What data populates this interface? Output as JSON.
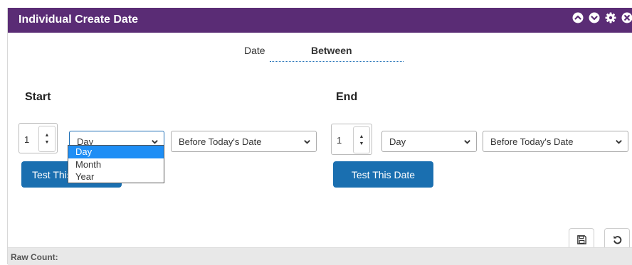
{
  "window": {
    "title": "Individual Create Date"
  },
  "tabs": [
    {
      "label": "Date"
    },
    {
      "label": "Between",
      "active": true
    }
  ],
  "start": {
    "label": "Start",
    "quantity": "1",
    "unit_selected": "Day",
    "relation_selected": "Before Today's Date",
    "test_button": "Test This Date",
    "unit_options": [
      "Day",
      "Month",
      "Year"
    ],
    "highlighted_option": "Day"
  },
  "end": {
    "label": "End",
    "quantity": "1",
    "unit_selected": "Day",
    "relation_selected": "Before Today's Date",
    "test_button": "Test This Date"
  },
  "footer": {
    "raw_count_label": "Raw Count:"
  },
  "icons": {
    "titlebar": [
      "chevron-up-circle-icon",
      "chevron-down-circle-icon",
      "gear-icon",
      "close-circle-icon"
    ],
    "actions": [
      "save-icon",
      "undo-icon"
    ]
  },
  "colors": {
    "titlebar_bg": "#5a2c75",
    "button_bg": "#1a6fb0",
    "dropdown_highlight": "#1e8ef5",
    "footer_bg": "#e8e8e8"
  }
}
